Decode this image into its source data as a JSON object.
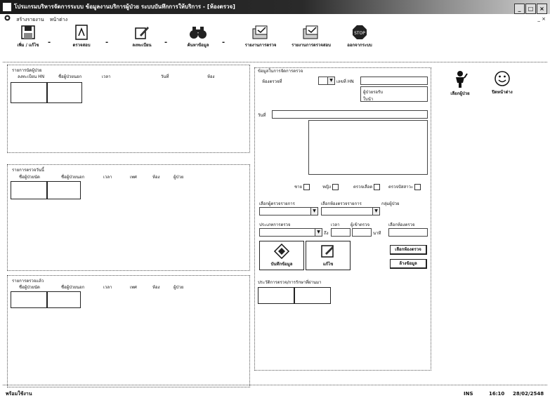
{
  "window": {
    "title": "โปรแกรมบริหารจัดการระบบ ข้อมูลงานบริการผู้ป่วย ระบบบันทึกการให้บริการ - [ห้องตรวจ]",
    "controls": [
      "_",
      "□",
      "×"
    ]
  },
  "menu": {
    "items": [
      "สร้างรายงาน",
      "หน้าต่าง"
    ],
    "right": "_ ×"
  },
  "toolbar": {
    "buttons": [
      {
        "label": "เพิ่ม / แก้ไข",
        "icon": "save-disk-icon"
      },
      {
        "label": "ตรวจสอบ",
        "icon": "document-pdf-icon"
      },
      {
        "label": "ลงทะเบียน",
        "icon": "edit-pen-icon"
      },
      {
        "label": "ค้นหาข้อมูล",
        "icon": "binoculars-icon"
      },
      {
        "label": "รายงานการตรวจ",
        "icon": "report-folder-icon"
      },
      {
        "label": "รายงานการตรวจสอบ",
        "icon": "report-folder-icon"
      },
      {
        "label": "ออกจากระบบ",
        "icon": "stop-sign-icon"
      }
    ],
    "separator": "-"
  },
  "left": {
    "panel1": {
      "title": "รายการนัดผู้ป่วย",
      "columns": [
        "ลงทะเบียน HN",
        "ชื่อผู้ป่วยนอก",
        "เวลา",
        "วันที่",
        "ห้อง"
      ]
    },
    "panel2": {
      "title": "รายการตรวจวันนี้",
      "columns": [
        "ชื่อผู้ป่วยนัด",
        "ชื่อผู้ป่วยนอก",
        "เวลา",
        "เพศ",
        "ห้อง",
        "ผู้ป่วย"
      ]
    },
    "panel3": {
      "title": "รายการตรวจแล้ว",
      "columns": [
        "ชื่อผู้ป่วยนัด",
        "ชื่อผู้ป่วยนอก",
        "เวลา",
        "เพศ",
        "ห้อง",
        "ผู้ป่วย"
      ]
    }
  },
  "right": {
    "group_title": "ข้อมูลในการจัดการตรวจ",
    "room_label": "ห้องตรวจที่",
    "hn_label": "เลขที่ HN",
    "note_text": "ผู้ป่วยรอรับ ใบนำ",
    "date_label": "วันที่",
    "checks": [
      "ชาย",
      "หญิง",
      "ตรวจเลือด",
      "ตรวจปัสสาวะ"
    ],
    "dropdown_labels": [
      "เลือกผู้ตรวจรายการ",
      "เลือกห้องตรวจรายการ",
      "กลุ่มผู้ป่วย"
    ],
    "exam_type_label": "ประเภทการตรวจ",
    "time_label": "เวลา",
    "doctor_label": "ผู้เข้าตรวจ",
    "pass_label": "เลือกห้องตรวจ",
    "to_label": "ถึง",
    "min_label": "นาที",
    "btn_save": "บันทึกข้อมูล",
    "btn_edit": "แก้ไข",
    "btn_select_room": "เลือกห้องตรวจ",
    "btn_clear": "ล้างข้อมูล",
    "history_title": "ประวัติการตรวจ/การรักษาที่ผ่านมา",
    "btn_select_patient": "เลือกผู้ป่วย",
    "btn_close": "ปิดหน้าต่าง"
  },
  "status": {
    "left": "พร้อมใช้งาน",
    "ins": "INS",
    "time": "16:10",
    "date": "28/02/2548"
  }
}
